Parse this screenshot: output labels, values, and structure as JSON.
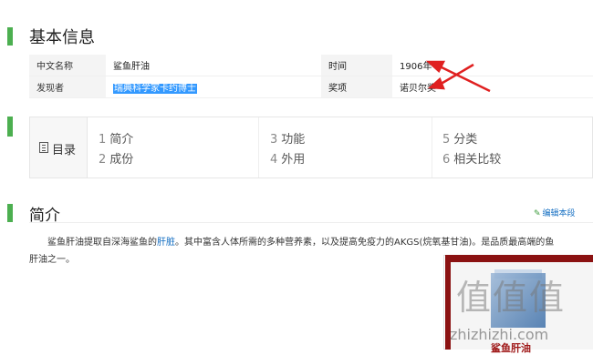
{
  "basic_info": {
    "title": "基本信息",
    "rows": [
      {
        "k1": "中文名称",
        "v1": "鲨鱼肝油",
        "k2": "时间",
        "v2": "1906年"
      },
      {
        "k1": "发现者",
        "v1": "瑞典科学家卡约博士",
        "k2": "奖项",
        "v2": "诺贝尔奖"
      }
    ]
  },
  "toc": {
    "label": "目录",
    "items": [
      {
        "num": "1",
        "text": "简介"
      },
      {
        "num": "2",
        "text": "成份"
      },
      {
        "num": "3",
        "text": "功能"
      },
      {
        "num": "4",
        "text": "外用"
      },
      {
        "num": "5",
        "text": "分类"
      },
      {
        "num": "6",
        "text": "相关比较"
      }
    ]
  },
  "intro": {
    "title": "简介",
    "edit_label": "编辑本段",
    "para_start": "鲨鱼肝油提取自深海鲨鱼的",
    "para_link": "肝脏",
    "para_rest": "。其中富含人体所需的多种营养素，以及提高免疫力的AKGS(烷氧基甘油)。是品质最高端的鱼",
    "para_line2": "肝油之一。"
  },
  "image": {
    "watermark": "值值值",
    "watermark_url": "zhizhizhi.com",
    "caption": "鲨鱼肝油"
  },
  "colors": {
    "accent": "#4caf50",
    "link": "#136ec2",
    "arrow": "#e02020"
  }
}
